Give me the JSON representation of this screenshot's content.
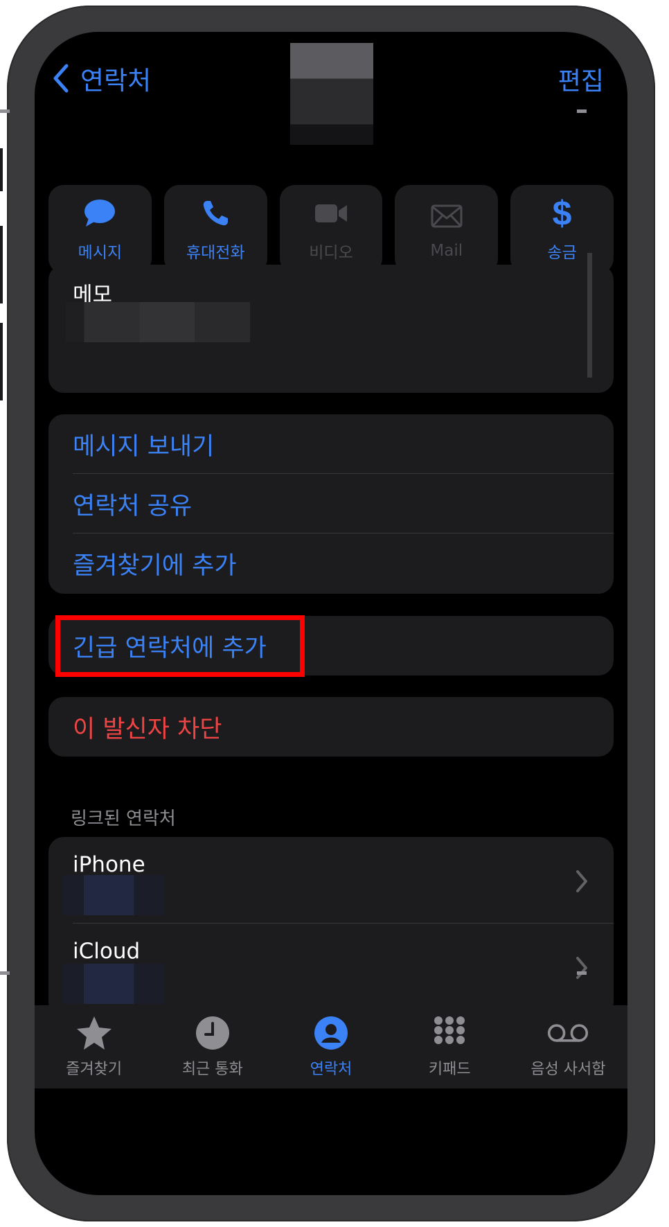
{
  "nav": {
    "back_label": "연락처",
    "edit_label": "편집"
  },
  "actions": [
    {
      "label": "메시지",
      "icon": "message-bubble-icon",
      "enabled": true
    },
    {
      "label": "휴대전화",
      "icon": "phone-icon",
      "enabled": true
    },
    {
      "label": "비디오",
      "icon": "video-icon",
      "enabled": false
    },
    {
      "label": "Mail",
      "icon": "mail-icon",
      "enabled": false
    },
    {
      "label": "송금",
      "icon": "dollar-icon",
      "enabled": true
    }
  ],
  "memo": {
    "label": "메모"
  },
  "options": [
    {
      "label": "메시지 보내기"
    },
    {
      "label": "연락처 공유"
    },
    {
      "label": "즐겨찾기에 추가"
    }
  ],
  "emergency": {
    "label": "긴급 연락처에 추가"
  },
  "block": {
    "label": "이 발신자 차단"
  },
  "linked": {
    "header": "링크된 연락처",
    "items": [
      {
        "title": "iPhone"
      },
      {
        "title": "iCloud"
      }
    ]
  },
  "tabs": [
    {
      "label": "즐겨찾기",
      "icon": "star-icon"
    },
    {
      "label": "최근 통화",
      "icon": "clock-icon"
    },
    {
      "label": "연락처",
      "icon": "person-circle-icon",
      "active": true
    },
    {
      "label": "키패드",
      "icon": "keypad-icon"
    },
    {
      "label": "음성 사서함",
      "icon": "voicemail-icon"
    }
  ],
  "colors": {
    "accent": "#3b82f6",
    "destructive": "#ef4444",
    "highlight": "#ff0000",
    "background": "#000000",
    "card": "#1c1c1e"
  }
}
